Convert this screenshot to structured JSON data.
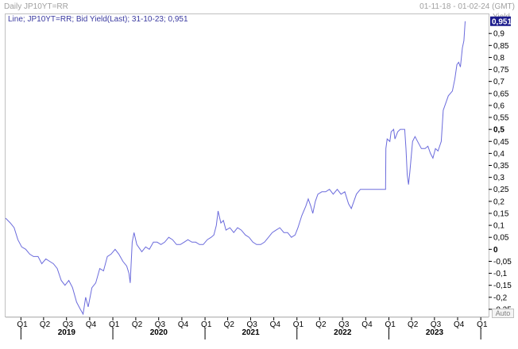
{
  "header": {
    "title": "Daily JP10YT=RR",
    "date_range": "01-11-18 - 01-02-24 (GMT)"
  },
  "legend": {
    "text": "Line; JP10YT=RR; Bid Yield(Last); 31-10-23; 0,951"
  },
  "axis": {
    "y_unit": "Yield",
    "auto_label": "Auto"
  },
  "colors": {
    "line": "#6b6bdc",
    "last_value_bg": "#1c1c8c"
  },
  "chart_data": {
    "type": "line",
    "ylim": [
      -0.28,
      0.98
    ],
    "ytick_values": [
      0.9,
      0.85,
      0.8,
      0.75,
      0.7,
      0.65,
      0.6,
      0.55,
      0.5,
      0.45,
      0.4,
      0.35,
      0.3,
      0.25,
      0.2,
      0.15,
      0.1,
      0.05,
      0,
      -0.05,
      -0.1,
      -0.15,
      -0.2,
      -0.25
    ],
    "ytick_labels": [
      "0,9",
      "0,85",
      "0,8",
      "0,75",
      "0,7",
      "0,65",
      "0,6",
      "0,55",
      "0,5",
      "0,45",
      "0,4",
      "0,35",
      "0,3",
      "0,25",
      "0,2",
      "0,15",
      "0,1",
      "0,05",
      "0",
      "-0,05",
      "-0,1",
      "-0,15",
      "-0,2",
      "-0,25"
    ],
    "last_value": 0.951,
    "last_value_label": "0,951",
    "xlim": [
      "2018-11-01",
      "2024-02-01"
    ],
    "quarter_ticks": [
      {
        "date": "2019-01-01",
        "label": "Q1"
      },
      {
        "date": "2019-04-01",
        "label": "Q2"
      },
      {
        "date": "2019-07-01",
        "label": "Q3"
      },
      {
        "date": "2019-10-01",
        "label": "Q4"
      },
      {
        "date": "2020-01-01",
        "label": "Q1"
      },
      {
        "date": "2020-04-01",
        "label": "Q2"
      },
      {
        "date": "2020-07-01",
        "label": "Q3"
      },
      {
        "date": "2020-10-01",
        "label": "Q4"
      },
      {
        "date": "2021-01-01",
        "label": "Q1"
      },
      {
        "date": "2021-04-01",
        "label": "Q2"
      },
      {
        "date": "2021-07-01",
        "label": "Q3"
      },
      {
        "date": "2021-10-01",
        "label": "Q4"
      },
      {
        "date": "2022-01-01",
        "label": "Q1"
      },
      {
        "date": "2022-04-01",
        "label": "Q2"
      },
      {
        "date": "2022-07-01",
        "label": "Q3"
      },
      {
        "date": "2022-10-01",
        "label": "Q4"
      },
      {
        "date": "2023-01-01",
        "label": "Q1"
      },
      {
        "date": "2023-04-01",
        "label": "Q2"
      },
      {
        "date": "2023-07-01",
        "label": "Q3"
      },
      {
        "date": "2023-10-01",
        "label": "Q4"
      },
      {
        "date": "2024-01-01",
        "label": "Q1"
      }
    ],
    "year_ticks": [
      {
        "date": "2019-07-01",
        "label": "2019"
      },
      {
        "date": "2020-07-01",
        "label": "2020"
      },
      {
        "date": "2021-07-01",
        "label": "2021"
      },
      {
        "date": "2022-07-01",
        "label": "2022"
      },
      {
        "date": "2023-07-01",
        "label": "2023"
      }
    ],
    "series": [
      {
        "points": [
          [
            "2018-11-01",
            0.13
          ],
          [
            "2018-11-20",
            0.11
          ],
          [
            "2018-12-05",
            0.09
          ],
          [
            "2018-12-20",
            0.04
          ],
          [
            "2019-01-04",
            0.01
          ],
          [
            "2019-01-20",
            0.0
          ],
          [
            "2019-02-05",
            -0.02
          ],
          [
            "2019-02-20",
            -0.03
          ],
          [
            "2019-03-10",
            -0.03
          ],
          [
            "2019-03-25",
            -0.06
          ],
          [
            "2019-04-10",
            -0.04
          ],
          [
            "2019-04-25",
            -0.05
          ],
          [
            "2019-05-10",
            -0.06
          ],
          [
            "2019-05-25",
            -0.08
          ],
          [
            "2019-06-10",
            -0.13
          ],
          [
            "2019-06-25",
            -0.15
          ],
          [
            "2019-07-10",
            -0.13
          ],
          [
            "2019-07-25",
            -0.16
          ],
          [
            "2019-08-10",
            -0.22
          ],
          [
            "2019-08-25",
            -0.25
          ],
          [
            "2019-09-05",
            -0.27
          ],
          [
            "2019-09-15",
            -0.2
          ],
          [
            "2019-09-25",
            -0.24
          ],
          [
            "2019-10-10",
            -0.16
          ],
          [
            "2019-10-25",
            -0.14
          ],
          [
            "2019-11-10",
            -0.08
          ],
          [
            "2019-11-25",
            -0.09
          ],
          [
            "2019-12-10",
            -0.03
          ],
          [
            "2019-12-25",
            -0.02
          ],
          [
            "2020-01-10",
            0.0
          ],
          [
            "2020-01-25",
            -0.02
          ],
          [
            "2020-02-10",
            -0.05
          ],
          [
            "2020-02-25",
            -0.07
          ],
          [
            "2020-03-05",
            -0.1
          ],
          [
            "2020-03-10",
            -0.14
          ],
          [
            "2020-03-18",
            0.03
          ],
          [
            "2020-03-25",
            0.07
          ],
          [
            "2020-04-05",
            0.02
          ],
          [
            "2020-04-25",
            -0.01
          ],
          [
            "2020-05-10",
            0.01
          ],
          [
            "2020-05-25",
            0.0
          ],
          [
            "2020-06-10",
            0.03
          ],
          [
            "2020-06-25",
            0.03
          ],
          [
            "2020-07-10",
            0.02
          ],
          [
            "2020-07-25",
            0.03
          ],
          [
            "2020-08-10",
            0.05
          ],
          [
            "2020-08-25",
            0.04
          ],
          [
            "2020-09-10",
            0.02
          ],
          [
            "2020-09-25",
            0.02
          ],
          [
            "2020-10-10",
            0.03
          ],
          [
            "2020-10-25",
            0.04
          ],
          [
            "2020-11-10",
            0.03
          ],
          [
            "2020-11-25",
            0.03
          ],
          [
            "2020-12-10",
            0.02
          ],
          [
            "2020-12-25",
            0.02
          ],
          [
            "2021-01-10",
            0.04
          ],
          [
            "2021-01-25",
            0.05
          ],
          [
            "2021-02-05",
            0.06
          ],
          [
            "2021-02-15",
            0.1
          ],
          [
            "2021-02-22",
            0.16
          ],
          [
            "2021-03-05",
            0.11
          ],
          [
            "2021-03-15",
            0.12
          ],
          [
            "2021-03-25",
            0.08
          ],
          [
            "2021-04-10",
            0.09
          ],
          [
            "2021-04-25",
            0.07
          ],
          [
            "2021-05-10",
            0.09
          ],
          [
            "2021-05-25",
            0.08
          ],
          [
            "2021-06-10",
            0.06
          ],
          [
            "2021-06-25",
            0.05
          ],
          [
            "2021-07-10",
            0.03
          ],
          [
            "2021-07-25",
            0.02
          ],
          [
            "2021-08-10",
            0.02
          ],
          [
            "2021-08-25",
            0.03
          ],
          [
            "2021-09-10",
            0.05
          ],
          [
            "2021-09-25",
            0.07
          ],
          [
            "2021-10-10",
            0.08
          ],
          [
            "2021-10-25",
            0.09
          ],
          [
            "2021-11-10",
            0.07
          ],
          [
            "2021-11-25",
            0.07
          ],
          [
            "2021-12-10",
            0.05
          ],
          [
            "2021-12-25",
            0.06
          ],
          [
            "2022-01-05",
            0.09
          ],
          [
            "2022-01-20",
            0.14
          ],
          [
            "2022-02-05",
            0.18
          ],
          [
            "2022-02-15",
            0.21
          ],
          [
            "2022-02-25",
            0.18
          ],
          [
            "2022-03-05",
            0.15
          ],
          [
            "2022-03-15",
            0.2
          ],
          [
            "2022-03-25",
            0.23
          ],
          [
            "2022-04-10",
            0.24
          ],
          [
            "2022-04-25",
            0.24
          ],
          [
            "2022-05-10",
            0.25
          ],
          [
            "2022-05-25",
            0.23
          ],
          [
            "2022-06-10",
            0.25
          ],
          [
            "2022-06-25",
            0.23
          ],
          [
            "2022-07-10",
            0.24
          ],
          [
            "2022-07-25",
            0.19
          ],
          [
            "2022-08-05",
            0.17
          ],
          [
            "2022-08-15",
            0.2
          ],
          [
            "2022-08-25",
            0.23
          ],
          [
            "2022-09-10",
            0.25
          ],
          [
            "2022-09-25",
            0.25
          ],
          [
            "2022-10-10",
            0.25
          ],
          [
            "2022-10-25",
            0.25
          ],
          [
            "2022-11-10",
            0.25
          ],
          [
            "2022-11-25",
            0.25
          ],
          [
            "2022-12-10",
            0.25
          ],
          [
            "2022-12-19",
            0.25
          ],
          [
            "2022-12-20",
            0.42
          ],
          [
            "2022-12-25",
            0.46
          ],
          [
            "2023-01-05",
            0.45
          ],
          [
            "2023-01-10",
            0.49
          ],
          [
            "2023-01-20",
            0.5
          ],
          [
            "2023-01-25",
            0.46
          ],
          [
            "2023-02-05",
            0.49
          ],
          [
            "2023-02-15",
            0.5
          ],
          [
            "2023-02-25",
            0.5
          ],
          [
            "2023-03-05",
            0.5
          ],
          [
            "2023-03-10",
            0.42
          ],
          [
            "2023-03-15",
            0.31
          ],
          [
            "2023-03-20",
            0.27
          ],
          [
            "2023-03-25",
            0.32
          ],
          [
            "2023-04-05",
            0.45
          ],
          [
            "2023-04-15",
            0.47
          ],
          [
            "2023-04-25",
            0.45
          ],
          [
            "2023-05-10",
            0.42
          ],
          [
            "2023-05-25",
            0.42
          ],
          [
            "2023-06-05",
            0.43
          ],
          [
            "2023-06-15",
            0.4
          ],
          [
            "2023-06-25",
            0.38
          ],
          [
            "2023-07-05",
            0.42
          ],
          [
            "2023-07-15",
            0.41
          ],
          [
            "2023-07-28",
            0.45
          ],
          [
            "2023-08-05",
            0.58
          ],
          [
            "2023-08-15",
            0.61
          ],
          [
            "2023-08-25",
            0.64
          ],
          [
            "2023-09-10",
            0.66
          ],
          [
            "2023-09-20",
            0.71
          ],
          [
            "2023-09-28",
            0.77
          ],
          [
            "2023-10-05",
            0.78
          ],
          [
            "2023-10-12",
            0.76
          ],
          [
            "2023-10-20",
            0.84
          ],
          [
            "2023-10-26",
            0.87
          ],
          [
            "2023-10-31",
            0.951
          ]
        ]
      }
    ]
  }
}
